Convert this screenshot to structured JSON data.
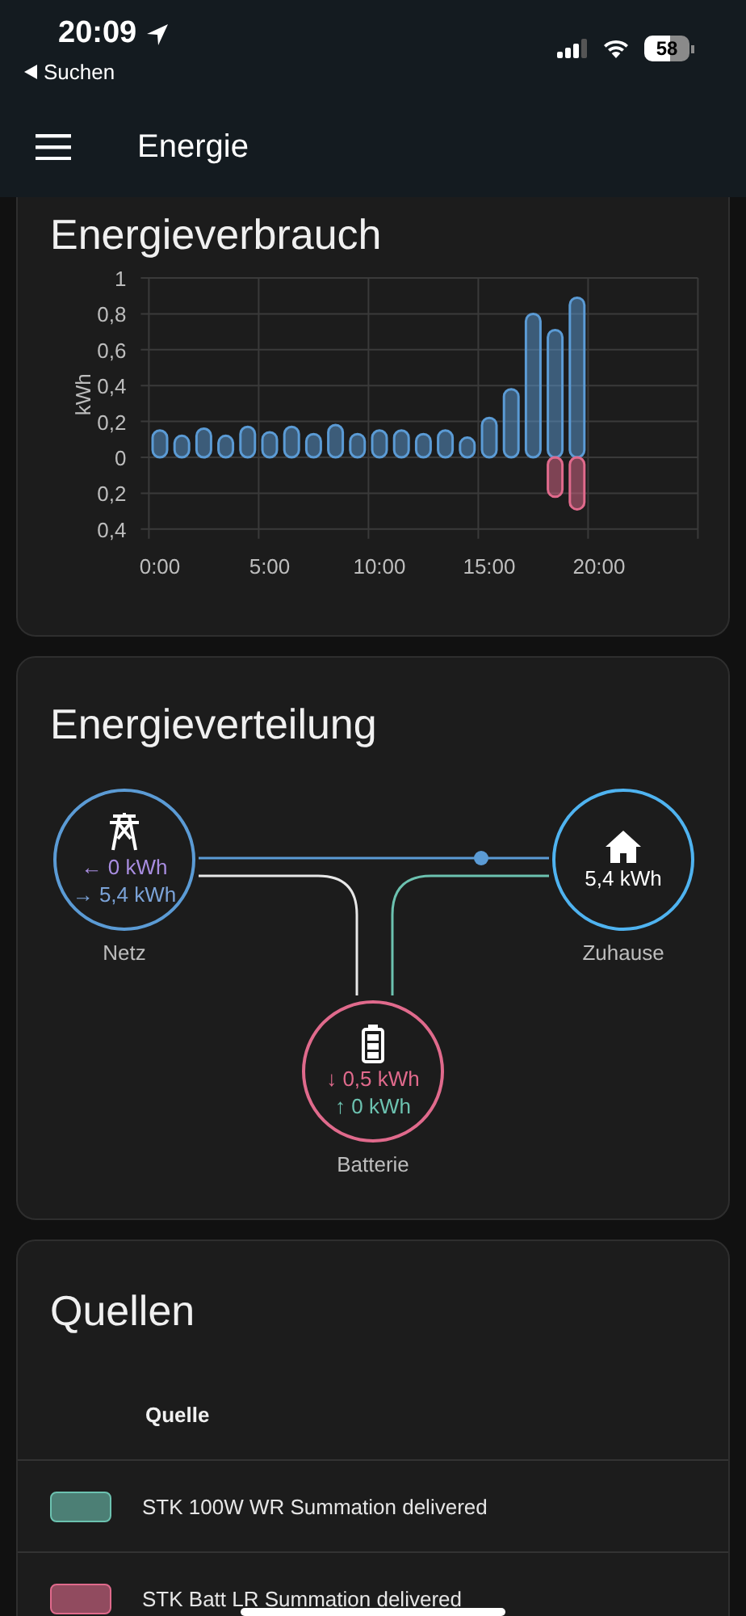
{
  "status_bar": {
    "time": "20:09",
    "back_label": "Suchen",
    "battery": "58"
  },
  "header": {
    "title": "Energie"
  },
  "usage_card": {
    "title": "Energieverbrauch",
    "chart_data": {
      "type": "bar",
      "ylabel": "kWh",
      "x": [
        0,
        1,
        2,
        3,
        4,
        5,
        6,
        7,
        8,
        9,
        10,
        11,
        12,
        13,
        14,
        15,
        16,
        17,
        18,
        19
      ],
      "xlim": [
        -0.5,
        24.5
      ],
      "grid": true,
      "ylim": [
        -0.4,
        1
      ],
      "xticks": [
        {
          "value": 0,
          "label": "0:00"
        },
        {
          "value": 5,
          "label": "5:00"
        },
        {
          "value": 10,
          "label": "10:00"
        },
        {
          "value": 15,
          "label": "15:00"
        },
        {
          "value": 20,
          "label": "20:00"
        }
      ],
      "yticks": [
        {
          "value": 1,
          "label": "1"
        },
        {
          "value": 0.8,
          "label": "0,8"
        },
        {
          "value": 0.6,
          "label": "0,6"
        },
        {
          "value": 0.4,
          "label": "0,4"
        },
        {
          "value": 0.2,
          "label": "0,2"
        },
        {
          "value": 0,
          "label": "0"
        },
        {
          "value": -0.2,
          "label": "0,2"
        },
        {
          "value": -0.4,
          "label": "0,4"
        }
      ],
      "series": [
        {
          "color": "#5b9bd5",
          "values": [
            0.15,
            0.12,
            0.16,
            0.12,
            0.17,
            0.14,
            0.17,
            0.13,
            0.18,
            0.13,
            0.15,
            0.15,
            0.13,
            0.15,
            0.11,
            0.22,
            0.38,
            0.8,
            0.71,
            0.89
          ]
        },
        {
          "color": "#e06a8c",
          "values": [
            0,
            0,
            0,
            0,
            0,
            0,
            0,
            0,
            0,
            0,
            0,
            0,
            0,
            0,
            0,
            0,
            0,
            0,
            -0.22,
            -0.29
          ]
        }
      ]
    }
  },
  "distribution_card": {
    "title": "Energieverteilung",
    "nodes": [
      {
        "kind": "grid",
        "label": "Netz",
        "color": "#5b9bd5",
        "readings": [
          {
            "text": "← 0 kWh",
            "color": "#a88de0"
          },
          {
            "text": "→ 5,4 kWh",
            "color": "#7ba3d8"
          }
        ]
      },
      {
        "kind": "home",
        "label": "Zuhause",
        "color": "#4fb3f0",
        "readings": [
          {
            "text": "5,4 kWh",
            "color": "#ffffff"
          }
        ]
      },
      {
        "kind": "battery",
        "label": "Batterie",
        "color": "#e06a8c",
        "readings": [
          {
            "text": "↓ 0,5 kWh",
            "color": "#e06a8c"
          },
          {
            "text": "↑ 0 kWh",
            "color": "#6cc2b0"
          }
        ]
      }
    ]
  },
  "sources_card": {
    "title": "Quellen",
    "column": "Quelle",
    "rows": [
      {
        "label": "STK 100W WR Summation delivered",
        "color": "#6cc2b0"
      },
      {
        "label": "STK Batt LR Summation delivered",
        "color": "#e06a8c"
      }
    ]
  }
}
